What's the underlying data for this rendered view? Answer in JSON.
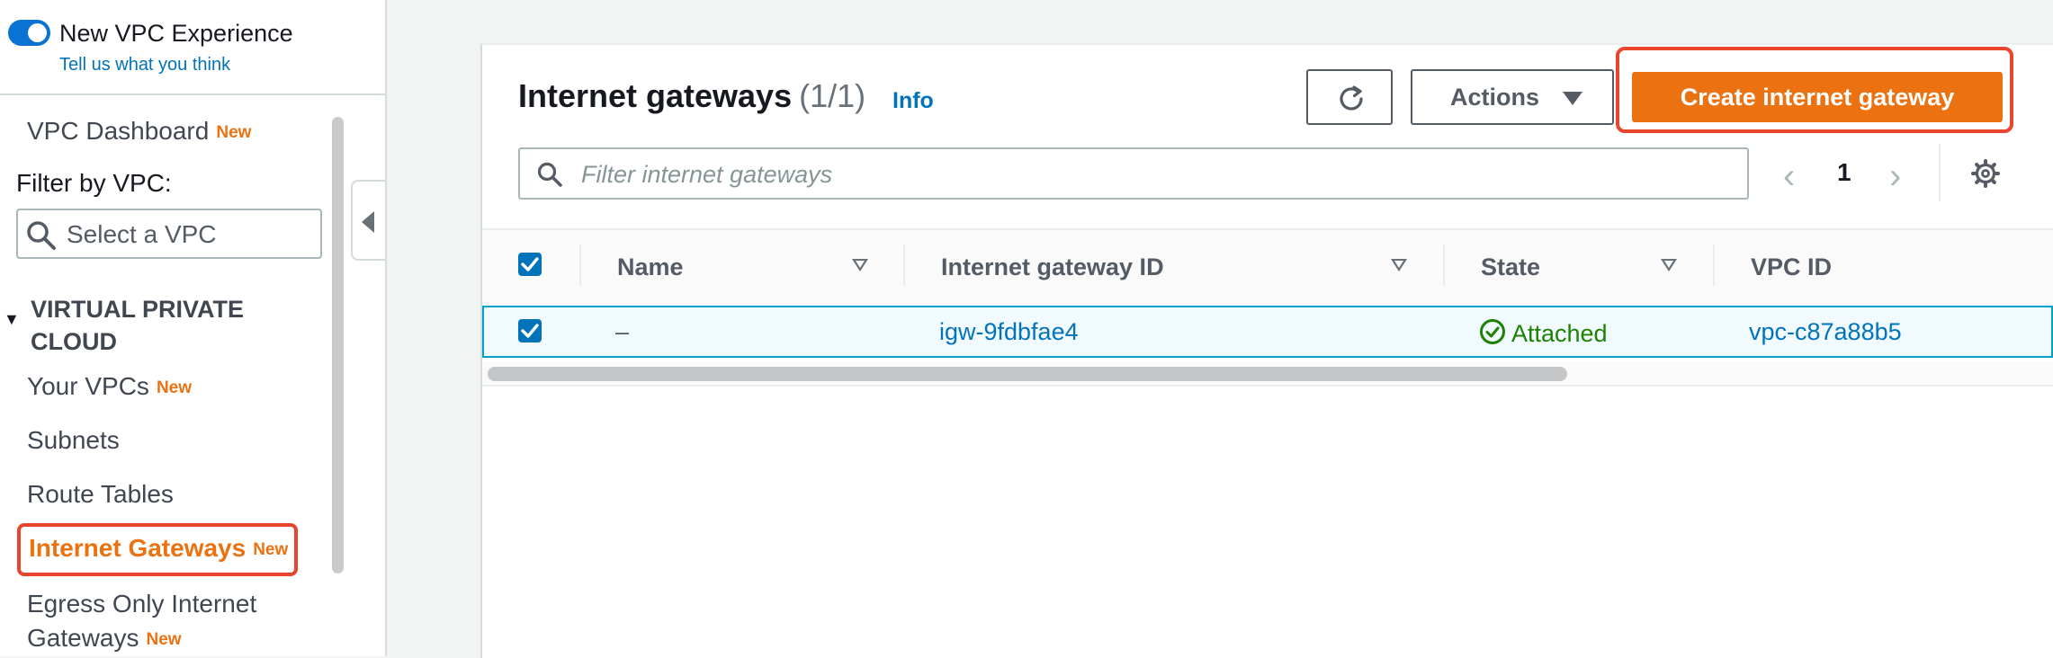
{
  "sidebar": {
    "toggle_label": "New VPC Experience",
    "toggle_on": true,
    "feedback_link": "Tell us what you think",
    "dashboard_label": "VPC Dashboard",
    "new_badge": "New",
    "filter_label": "Filter by VPC:",
    "filter_placeholder": "Select a VPC",
    "section_title": "VIRTUAL PRIVATE CLOUD",
    "items": [
      {
        "label": "Your VPCs",
        "badge": "New"
      },
      {
        "label": "Subnets",
        "badge": ""
      },
      {
        "label": "Route Tables",
        "badge": ""
      },
      {
        "label": "Internet Gateways",
        "badge": "New",
        "active": true
      },
      {
        "label": "Egress Only Internet",
        "label2": "Gateways",
        "badge": "New"
      }
    ]
  },
  "panel": {
    "title": "Internet gateways",
    "count": "(1/1)",
    "info_link": "Info",
    "actions_label": "Actions",
    "create_label": "Create internet gateway",
    "filter_placeholder": "Filter internet gateways",
    "page_number": "1",
    "columns": [
      "Name",
      "Internet gateway ID",
      "State",
      "VPC ID"
    ],
    "rows": [
      {
        "selected": true,
        "name": "–",
        "gateway_id": "igw-9fdbfae4",
        "state": "Attached",
        "vpc_id": "vpc-c87a88b5"
      }
    ]
  },
  "icons": {
    "toggle": "toggle-switch-icon",
    "search": "search-icon",
    "refresh": "refresh-icon",
    "caret": "caret-down-icon",
    "settings": "gear-icon",
    "status": "check-circle-icon",
    "collapse": "collapse-left-icon"
  },
  "colors": {
    "accent": "#ec7211",
    "link": "#0073bb",
    "highlight": "#e8452c",
    "success": "#1d8102",
    "toggle": "#0972d3"
  }
}
